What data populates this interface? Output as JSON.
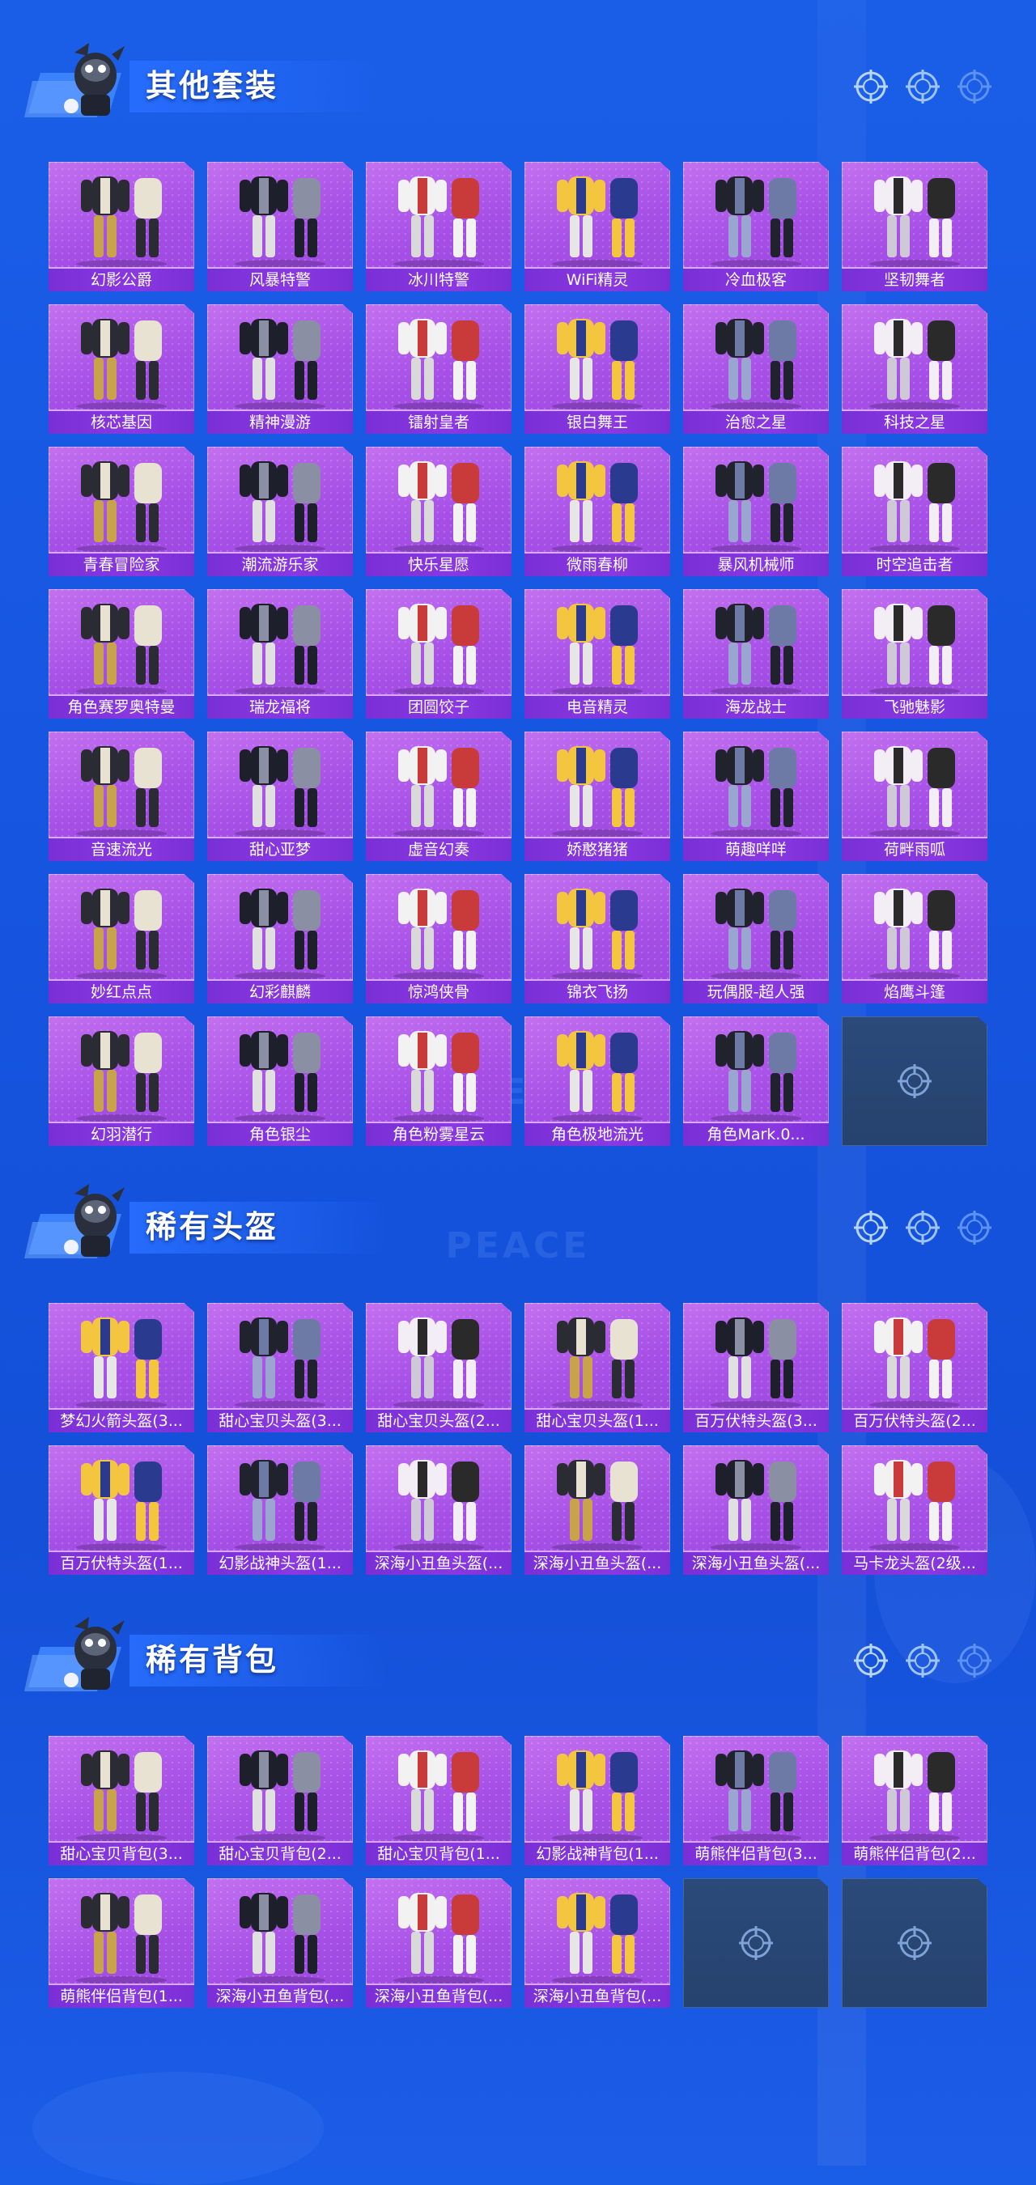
{
  "sections": [
    {
      "title": "其他套装",
      "items": [
        "幻影公爵",
        "风暴特警",
        "冰川特警",
        "WiFi精灵",
        "冷血极客",
        "坚韧舞者",
        "核芯基因",
        "精神漫游",
        "镭射皇者",
        "银白舞王",
        "治愈之星",
        "科技之星",
        "青春冒险家",
        "潮流游乐家",
        "快乐星愿",
        "微雨春柳",
        "暴风机械师",
        "时空追击者",
        "角色赛罗奥特曼",
        "瑞龙福将",
        "团圆饺子",
        "电音精灵",
        "海龙战士",
        "飞驰魅影",
        "音速流光",
        "甜心亚梦",
        "虚音幻奏",
        "娇憨猪猪",
        "萌趣咩咩",
        "荷畔雨呱",
        "妙红点点",
        "幻彩麒麟",
        "惊鸿侠骨",
        "锦衣飞扬",
        "玩偶服-超人强",
        "焰鹰斗篷",
        "幻羽潜行",
        "角色银尘",
        "角色粉雾星云",
        "角色极地流光",
        "角色Mark.0..."
      ],
      "empty_slots": 1
    },
    {
      "title": "稀有头盔",
      "items": [
        "梦幻火箭头盔(3...",
        "甜心宝贝头盔(3...",
        "甜心宝贝头盔(2...",
        "甜心宝贝头盔(1...",
        "百万伏特头盔(3...",
        "百万伏特头盔(2...",
        "百万伏特头盔(1...",
        "幻影战神头盔(1...",
        "深海小丑鱼头盔(...",
        "深海小丑鱼头盔(...",
        "深海小丑鱼头盔(...",
        "马卡龙头盔(2级..."
      ],
      "empty_slots": 0
    },
    {
      "title": "稀有背包",
      "items": [
        "甜心宝贝背包(3...",
        "甜心宝贝背包(2...",
        "甜心宝贝背包(1...",
        "幻影战神背包(1...",
        "萌熊伴侣背包(3...",
        "萌熊伴侣背包(2...",
        "萌熊伴侣背包(1...",
        "深海小丑鱼背包(...",
        "深海小丑鱼背包(...",
        "深海小丑鱼背包(..."
      ],
      "empty_slots": 2
    }
  ],
  "watermark": "GAME FOR PEACE",
  "icons": {
    "header_decoration": "crosshair-target-icon",
    "empty_slot": "crosshair-target-icon",
    "mascot": "mascot-logo"
  },
  "colors": {
    "background": "#1655e0",
    "card_purple": "#a54fe6",
    "label_bar": "#7a2fd6",
    "empty_slot": "#2b4a7a"
  }
}
